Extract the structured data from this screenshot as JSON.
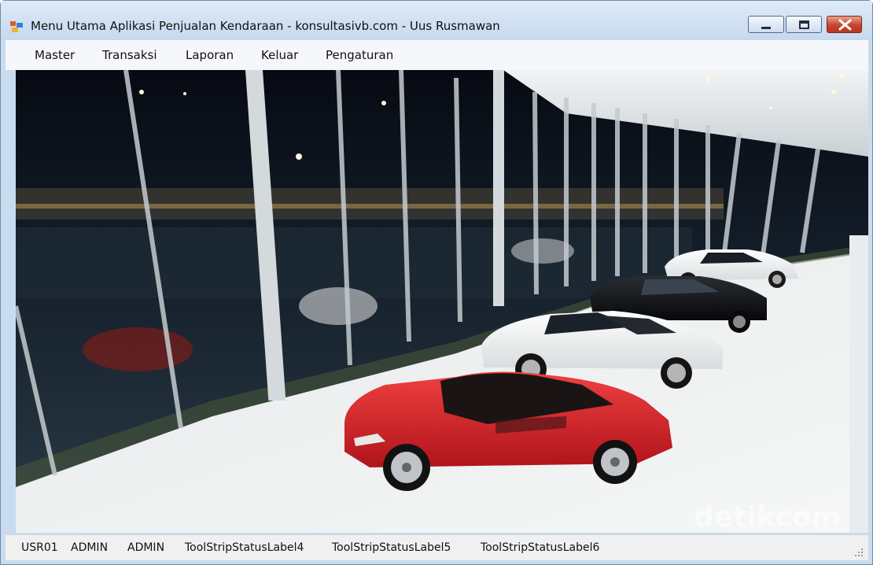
{
  "window": {
    "title": "Menu Utama Aplikasi Penjualan Kendaraan - konsultasivb.com - Uus Rusmawan",
    "icon": "app-form-icon"
  },
  "controls": {
    "minimize_icon": "minimize-icon",
    "maximize_icon": "maximize-icon",
    "close_icon": "close-icon"
  },
  "menu": {
    "items": [
      {
        "label": "Master"
      },
      {
        "label": "Transaksi"
      },
      {
        "label": "Laporan"
      },
      {
        "label": "Keluar"
      },
      {
        "label": "Pengaturan"
      }
    ]
  },
  "background_image": {
    "watermark": "detikcom"
  },
  "status": {
    "labels": [
      "USR01",
      "ADMIN",
      "ADMIN",
      "ToolStripStatusLabel4",
      "ToolStripStatusLabel5",
      "ToolStripStatusLabel6"
    ]
  },
  "colors": {
    "frame": "#c9dcef",
    "close_button": "#c7442f",
    "menubar": "#f5f7fa",
    "statusbar": "#f0f0f0",
    "red_car": "#d8232a"
  }
}
